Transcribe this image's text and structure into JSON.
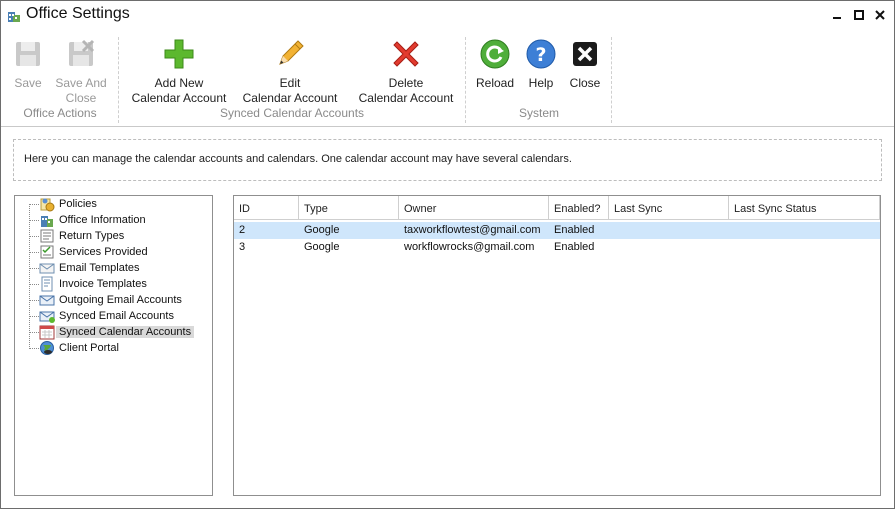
{
  "window": {
    "title": "Office Settings"
  },
  "ribbon": {
    "groups": [
      {
        "label": "Office Actions",
        "buttons": [
          {
            "label_line1": "Save",
            "label_line2": "",
            "icon": "floppy-disk-icon",
            "enabled": false
          },
          {
            "label_line1": "Save And",
            "label_line2": "Close",
            "icon": "floppy-disk-close-icon",
            "enabled": false
          }
        ]
      },
      {
        "label": "Synced Calendar Accounts",
        "buttons": [
          {
            "label_line1": "Add New",
            "label_line2": "Calendar Account",
            "icon": "green-plus-icon",
            "enabled": true
          },
          {
            "label_line1": "Edit",
            "label_line2": "Calendar Account",
            "icon": "pencil-icon",
            "enabled": true
          },
          {
            "label_line1": "Delete",
            "label_line2": "Calendar Account",
            "icon": "red-x-icon",
            "enabled": true
          }
        ]
      },
      {
        "label": "System",
        "buttons": [
          {
            "label_line1": "Reload",
            "label_line2": "",
            "icon": "reload-icon",
            "enabled": true
          },
          {
            "label_line1": "Help",
            "label_line2": "",
            "icon": "help-icon",
            "enabled": true
          },
          {
            "label_line1": "Close",
            "label_line2": "",
            "icon": "close-icon",
            "enabled": true
          }
        ]
      }
    ]
  },
  "info": {
    "text": "Here you can manage the calendar accounts and calendars. One calendar account may have several calendars."
  },
  "tree": {
    "items": [
      {
        "label": "Policies",
        "icon": "policies-icon",
        "selected": false
      },
      {
        "label": "Office Information",
        "icon": "office-information-icon",
        "selected": false
      },
      {
        "label": "Return Types",
        "icon": "return-types-icon",
        "selected": false
      },
      {
        "label": "Services Provided",
        "icon": "services-icon",
        "selected": false
      },
      {
        "label": "Email Templates",
        "icon": "email-template-icon",
        "selected": false
      },
      {
        "label": "Invoice Templates",
        "icon": "invoice-template-icon",
        "selected": false
      },
      {
        "label": "Outgoing Email Accounts",
        "icon": "outgoing-email-icon",
        "selected": false
      },
      {
        "label": "Synced Email Accounts",
        "icon": "synced-email-icon",
        "selected": false
      },
      {
        "label": "Synced Calendar Accounts",
        "icon": "calendar-icon",
        "selected": true
      },
      {
        "label": "Client Portal",
        "icon": "globe-icon",
        "selected": false
      }
    ]
  },
  "grid": {
    "columns": [
      "ID",
      "Type",
      "Owner",
      "Enabled?",
      "Last Sync",
      "Last Sync Status"
    ],
    "rows": [
      [
        "2",
        "Google",
        "taxworkflowtest@gmail.com",
        "Enabled",
        "",
        ""
      ],
      [
        "3",
        "Google",
        "workflowrocks@gmail.com",
        "Enabled",
        "",
        ""
      ]
    ],
    "selected_row": 0
  },
  "colors": {
    "selection": "#cfe6fb",
    "tree_selection": "#d9d9d9",
    "border": "#8f8f8f"
  }
}
